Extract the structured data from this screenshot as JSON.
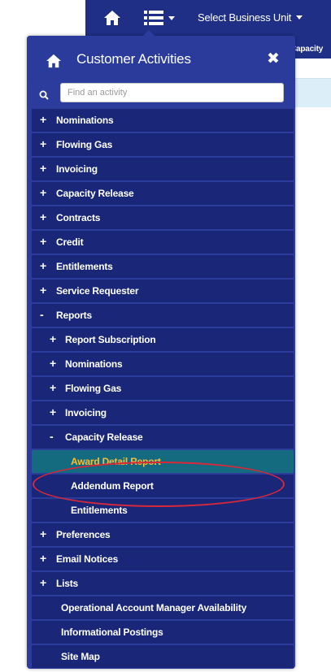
{
  "topbar": {
    "business_unit": "Select Business Unit",
    "home_icon": "home-icon",
    "menu_icon": "list-menu-icon"
  },
  "background": {
    "subnav_text": "Capacity"
  },
  "panel": {
    "title": "Customer Activities",
    "close_icon": "close-icon",
    "home_icon": "home-icon",
    "search": {
      "placeholder": "Find an activity",
      "value": ""
    },
    "items": [
      {
        "label": "Nominations",
        "symbol": "+",
        "level": 0
      },
      {
        "label": "Flowing Gas",
        "symbol": "+",
        "level": 0
      },
      {
        "label": "Invoicing",
        "symbol": "+",
        "level": 0
      },
      {
        "label": "Capacity Release",
        "symbol": "+",
        "level": 0
      },
      {
        "label": "Contracts",
        "symbol": "+",
        "level": 0
      },
      {
        "label": "Credit",
        "symbol": "+",
        "level": 0
      },
      {
        "label": "Entitlements",
        "symbol": "+",
        "level": 0
      },
      {
        "label": "Service Requester",
        "symbol": "+",
        "level": 0
      },
      {
        "label": "Reports",
        "symbol": "-",
        "level": 0
      },
      {
        "label": "Report Subscription",
        "symbol": "+",
        "level": 1
      },
      {
        "label": "Nominations",
        "symbol": "+",
        "level": 1
      },
      {
        "label": "Flowing Gas",
        "symbol": "+",
        "level": 1
      },
      {
        "label": "Invoicing",
        "symbol": "+",
        "level": 1
      },
      {
        "label": "Capacity Release",
        "symbol": "-",
        "level": 1
      },
      {
        "label": "Award Detail Report",
        "symbol": "",
        "level": 2,
        "active": true
      },
      {
        "label": "Addendum Report",
        "symbol": "",
        "level": 2
      },
      {
        "label": "Entitlements",
        "symbol": "",
        "level": 2
      },
      {
        "label": "Preferences",
        "symbol": "+",
        "level": 0
      },
      {
        "label": "Email Notices",
        "symbol": "+",
        "level": 0
      },
      {
        "label": "Lists",
        "symbol": "+",
        "level": 0
      },
      {
        "label": "Operational Account Manager Availability",
        "symbol": "",
        "level": 0
      },
      {
        "label": "Informational Postings",
        "symbol": "",
        "level": 0
      },
      {
        "label": "Site Map",
        "symbol": "",
        "level": 0
      }
    ]
  },
  "colors": {
    "topbar": "#1f2f86",
    "panel": "#2c3c9c",
    "item": "#1a2778",
    "active_item": "#146a7f",
    "active_text": "#f7bf36",
    "highlight_oval": "#d8283a"
  }
}
